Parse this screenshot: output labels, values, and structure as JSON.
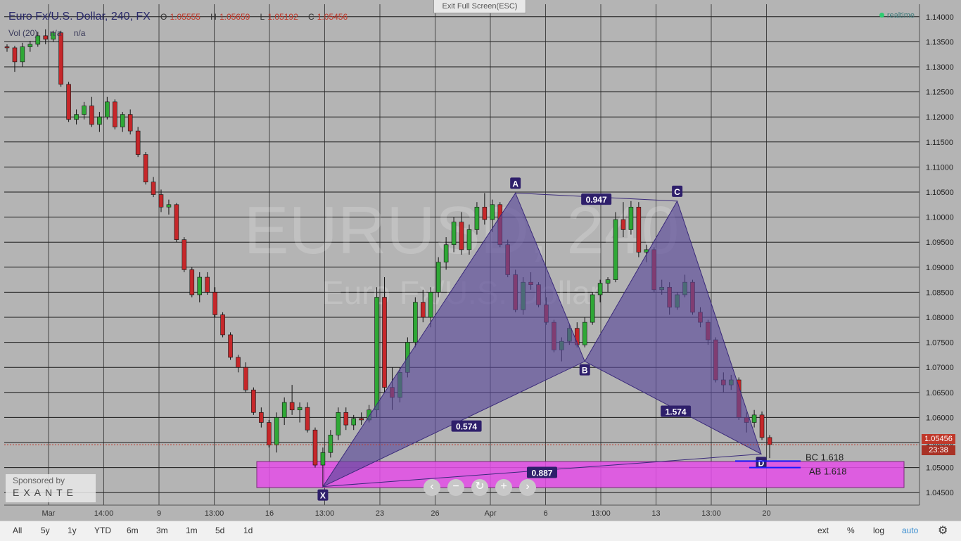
{
  "header": {
    "symbol": "Euro Fx/U.S. Dollar, 240, FX",
    "open_label": "O",
    "open": "1.05555",
    "high_label": "H",
    "high": "1.05659",
    "low_label": "L",
    "low": "1.05192",
    "close_label": "C",
    "close": "1.05456",
    "vol_label": "Vol (20)",
    "vol_v1": "n/a",
    "vol_v2": "n/a"
  },
  "exit_fullscreen": "Exit Full Screen(ESC)",
  "realtime_label": "realtime",
  "watermark": {
    "line1": "EURUSD, 240",
    "line2": "Euro Fx/U.S. Dollar"
  },
  "sponsor": {
    "line1": "Sponsored by",
    "line2": "EXANTE"
  },
  "price_badge": "1.05456",
  "countdown_badge": "23:38",
  "range_buttons": [
    "All",
    "5y",
    "1y",
    "YTD",
    "6m",
    "3m",
    "1m",
    "5d",
    "1d"
  ],
  "right_buttons": [
    "ext",
    "%",
    "log",
    "auto"
  ],
  "colors": {
    "bull": "#2fa836",
    "bear": "#c6272a",
    "pattern_fill": "#5a4a9a",
    "zone": "#e44ee8",
    "price_line": "#c0392b"
  },
  "chart_data": {
    "type": "candlestick",
    "ylim": [
      1.0425,
      1.1425
    ],
    "y_ticks": [
      "1.14000",
      "1.13500",
      "1.13000",
      "1.12500",
      "1.12000",
      "1.11500",
      "1.11000",
      "1.10500",
      "1.10000",
      "1.09500",
      "1.09000",
      "1.08500",
      "1.08000",
      "1.07500",
      "1.07000",
      "1.06500",
      "1.06000",
      "1.05500",
      "1.05000",
      "1.04500"
    ],
    "x_ticks": [
      "Mar",
      "14:00",
      "9",
      "13:00",
      "16",
      "13:00",
      "23",
      "26",
      "Apr",
      "6",
      "13:00",
      "13",
      "13:00",
      "20"
    ],
    "current_price": 1.05456,
    "candles": [
      [
        1.134,
        1.1345,
        1.133,
        1.1338
      ],
      [
        1.1338,
        1.1342,
        1.129,
        1.131
      ],
      [
        1.131,
        1.1348,
        1.13,
        1.134
      ],
      [
        1.134,
        1.1352,
        1.133,
        1.1345
      ],
      [
        1.1345,
        1.137,
        1.134,
        1.1362
      ],
      [
        1.1362,
        1.1375,
        1.1345,
        1.1355
      ],
      [
        1.1355,
        1.1372,
        1.135,
        1.1368
      ],
      [
        1.1368,
        1.1372,
        1.126,
        1.1265
      ],
      [
        1.1265,
        1.127,
        1.119,
        1.1195
      ],
      [
        1.1195,
        1.1215,
        1.1185,
        1.1205
      ],
      [
        1.1205,
        1.123,
        1.1195,
        1.1222
      ],
      [
        1.1222,
        1.124,
        1.118,
        1.1185
      ],
      [
        1.1185,
        1.121,
        1.117,
        1.12
      ],
      [
        1.12,
        1.124,
        1.1195,
        1.123
      ],
      [
        1.123,
        1.1235,
        1.1175,
        1.118
      ],
      [
        1.118,
        1.121,
        1.117,
        1.1205
      ],
      [
        1.1205,
        1.1215,
        1.1165,
        1.1172
      ],
      [
        1.1172,
        1.118,
        1.112,
        1.1125
      ],
      [
        1.1125,
        1.113,
        1.1065,
        1.107
      ],
      [
        1.107,
        1.108,
        1.104,
        1.1045
      ],
      [
        1.1045,
        1.1055,
        1.101,
        1.102
      ],
      [
        1.102,
        1.1035,
        1.1005,
        1.1025
      ],
      [
        1.1025,
        1.1028,
        1.095,
        1.0955
      ],
      [
        1.0955,
        1.096,
        1.089,
        1.0895
      ],
      [
        1.0895,
        1.09,
        1.084,
        1.0845
      ],
      [
        1.0845,
        1.089,
        1.083,
        1.088
      ],
      [
        1.088,
        1.089,
        1.0845,
        1.085
      ],
      [
        1.085,
        1.086,
        1.08,
        1.0805
      ],
      [
        1.0805,
        1.081,
        1.076,
        1.0765
      ],
      [
        1.0765,
        1.077,
        1.0715,
        1.072
      ],
      [
        1.072,
        1.0725,
        1.069,
        1.07
      ],
      [
        1.07,
        1.071,
        1.065,
        1.0655
      ],
      [
        1.0655,
        1.066,
        1.0605,
        1.061
      ],
      [
        1.061,
        1.062,
        1.058,
        1.059
      ],
      [
        1.059,
        1.0595,
        1.054,
        1.0545
      ],
      [
        1.0545,
        1.061,
        1.053,
        1.06
      ],
      [
        1.06,
        1.064,
        1.0585,
        1.063
      ],
      [
        1.063,
        1.0665,
        1.0605,
        1.0615
      ],
      [
        1.0615,
        1.063,
        1.059,
        1.062
      ],
      [
        1.062,
        1.063,
        1.057,
        1.0575
      ],
      [
        1.0575,
        1.058,
        1.05,
        1.0505
      ],
      [
        1.0505,
        1.054,
        1.0462,
        1.053
      ],
      [
        1.053,
        1.0575,
        1.052,
        1.0565
      ],
      [
        1.0565,
        1.062,
        1.0555,
        1.061
      ],
      [
        1.061,
        1.062,
        1.0575,
        1.0585
      ],
      [
        1.0585,
        1.0605,
        1.0575,
        1.0598
      ],
      [
        1.0598,
        1.061,
        1.0585,
        1.0595
      ],
      [
        1.0595,
        1.0625,
        1.059,
        1.0615
      ],
      [
        1.0615,
        1.086,
        1.06,
        1.084
      ],
      [
        1.084,
        1.088,
        1.065,
        1.066
      ],
      [
        1.066,
        1.07,
        1.0615,
        1.064
      ],
      [
        1.064,
        1.07,
        1.063,
        1.069
      ],
      [
        1.069,
        1.076,
        1.068,
        1.075
      ],
      [
        1.075,
        1.084,
        1.074,
        1.083
      ],
      [
        1.083,
        1.0855,
        1.079,
        1.08
      ],
      [
        1.08,
        1.086,
        1.078,
        1.085
      ],
      [
        1.085,
        1.092,
        1.084,
        1.091
      ],
      [
        1.091,
        1.096,
        1.0895,
        1.0945
      ],
      [
        1.0945,
        1.1,
        1.093,
        1.099
      ],
      [
        1.099,
        1.101,
        1.0925,
        1.0935
      ],
      [
        1.0935,
        1.0985,
        1.0925,
        1.0975
      ],
      [
        1.0975,
        1.103,
        1.0965,
        1.102
      ],
      [
        1.102,
        1.1048,
        1.0985,
        1.0995
      ],
      [
        1.0995,
        1.1035,
        1.097,
        1.1025
      ],
      [
        1.1025,
        1.103,
        1.094,
        1.0945
      ],
      [
        1.0945,
        1.0955,
        1.088,
        1.0885
      ],
      [
        1.0885,
        1.0895,
        1.081,
        1.0815
      ],
      [
        1.0815,
        1.088,
        1.0805,
        1.087
      ],
      [
        1.087,
        1.089,
        1.0855,
        1.0865
      ],
      [
        1.0865,
        1.087,
        1.082,
        1.0825
      ],
      [
        1.0825,
        1.084,
        1.0785,
        1.079
      ],
      [
        1.079,
        1.0795,
        1.073,
        1.0735
      ],
      [
        1.0735,
        1.076,
        1.0712,
        1.0752
      ],
      [
        1.0752,
        1.0785,
        1.0745,
        1.0778
      ],
      [
        1.0778,
        1.079,
        1.074,
        1.0745
      ],
      [
        1.0745,
        1.08,
        1.074,
        1.079
      ],
      [
        1.079,
        1.085,
        1.0785,
        1.0845
      ],
      [
        1.0845,
        1.0875,
        1.083,
        1.0868
      ],
      [
        1.0868,
        1.088,
        1.085,
        1.0875
      ],
      [
        1.0875,
        1.101,
        1.087,
        1.0995
      ],
      [
        1.0995,
        1.103,
        1.096,
        1.0975
      ],
      [
        1.0975,
        1.1032,
        1.0965,
        1.102
      ],
      [
        1.102,
        1.103,
        1.092,
        1.093
      ],
      [
        1.093,
        1.0945,
        1.091,
        1.0935
      ],
      [
        1.0935,
        1.094,
        1.085,
        1.0855
      ],
      [
        1.0855,
        1.0875,
        1.0845,
        1.086
      ],
      [
        1.086,
        1.087,
        1.0805,
        1.082
      ],
      [
        1.082,
        1.085,
        1.0815,
        1.0845
      ],
      [
        1.0845,
        1.0885,
        1.084,
        1.087
      ],
      [
        1.087,
        1.0875,
        1.0805,
        1.081
      ],
      [
        1.081,
        1.082,
        1.078,
        1.079
      ],
      [
        1.079,
        1.0795,
        1.0745,
        1.0755
      ],
      [
        1.0755,
        1.076,
        1.067,
        1.0675
      ],
      [
        1.0675,
        1.069,
        1.065,
        1.0665
      ],
      [
        1.0665,
        1.0685,
        1.0655,
        1.0675
      ],
      [
        1.0675,
        1.068,
        1.0595,
        1.06
      ],
      [
        1.06,
        1.061,
        1.057,
        1.059
      ],
      [
        1.059,
        1.0615,
        1.058,
        1.0605
      ],
      [
        1.0605,
        1.0612,
        1.0555,
        1.056
      ],
      [
        1.056,
        1.0565,
        1.0519,
        1.0546
      ]
    ]
  },
  "pattern": {
    "points": [
      {
        "label": "X",
        "price": 1.0462
      },
      {
        "label": "A",
        "price": 1.1048
      },
      {
        "label": "B",
        "price": 1.0712
      },
      {
        "label": "C",
        "price": 1.1032
      },
      {
        "label": "D",
        "price": 1.0527
      }
    ],
    "ratios": {
      "xab": "0.574",
      "abc": "0.947",
      "bcd": "1.574",
      "xad": "0.887"
    },
    "projections": [
      {
        "label": "BC 1.618",
        "price": 1.0513
      },
      {
        "label": "AB 1.618",
        "price": 1.05
      }
    ],
    "zone": {
      "top": 1.0512,
      "bottom": 1.046
    }
  }
}
